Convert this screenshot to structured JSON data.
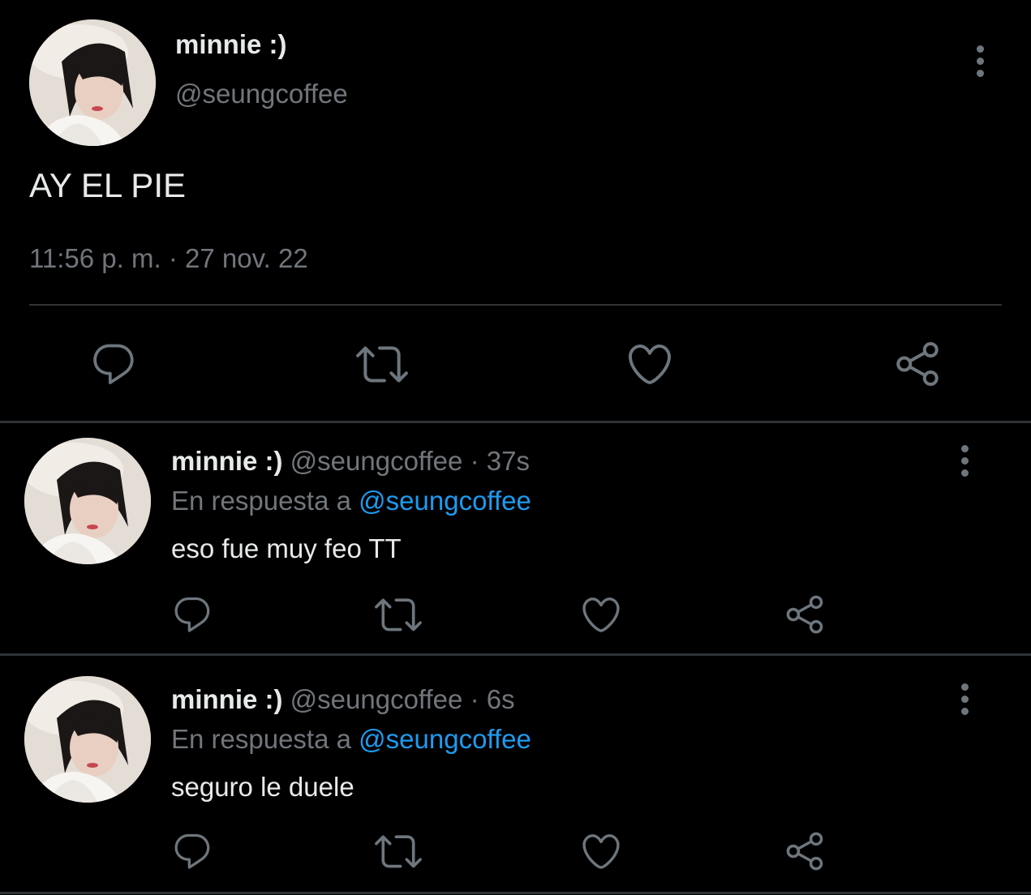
{
  "main_tweet": {
    "display_name": "minnie :)",
    "handle": "@seungcoffee",
    "text": "AY EL PIE",
    "time": "11:56 p. m.",
    "separator": "·",
    "date": "27 nov. 22"
  },
  "replies": [
    {
      "display_name": "minnie :)",
      "handle": "@seungcoffee",
      "separator": "·",
      "age": "37s",
      "reply_prefix": "En respuesta a",
      "reply_to": "@seungcoffee",
      "text": "eso fue muy feo TT"
    },
    {
      "display_name": "minnie :)",
      "handle": "@seungcoffee",
      "separator": "·",
      "age": "6s",
      "reply_prefix": "En respuesta a",
      "reply_to": "@seungcoffee",
      "text": "seguro le duele"
    }
  ],
  "icons": {
    "reply": "reply-icon",
    "retweet": "retweet-icon",
    "like": "heart-icon",
    "share": "share-icon",
    "more": "more-vertical-icon"
  },
  "colors": {
    "background": "#000000",
    "primary_text": "#e7e9ea",
    "secondary_text": "#71767b",
    "link": "#1d9bf0",
    "divider": "#2f3336"
  }
}
